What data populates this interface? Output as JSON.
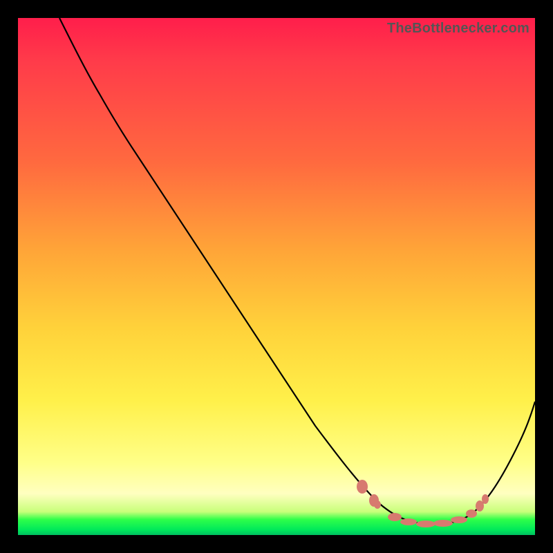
{
  "watermark": "TheBottlenecker.com",
  "chart_data": {
    "type": "line",
    "title": "",
    "xlabel": "",
    "ylabel": "",
    "xlim": [
      0,
      100
    ],
    "ylim": [
      0,
      100
    ],
    "series": [
      {
        "name": "curve",
        "x": [
          8,
          10,
          14,
          18,
          25,
          35,
          45,
          55,
          62,
          67,
          70,
          73,
          76,
          79,
          82,
          85,
          88,
          90,
          93,
          96,
          100
        ],
        "y": [
          100,
          98,
          94,
          90,
          80,
          65,
          50,
          35,
          24,
          16,
          11,
          8,
          6,
          5,
          5,
          5,
          6,
          8,
          12,
          18,
          27
        ]
      }
    ],
    "markers": [
      {
        "x": 67,
        "y": 15
      },
      {
        "x": 69,
        "y": 12
      },
      {
        "x": 72,
        "y": 8
      },
      {
        "x": 74,
        "y": 6
      },
      {
        "x": 77,
        "y": 5
      },
      {
        "x": 80,
        "y": 5
      },
      {
        "x": 83,
        "y": 5
      },
      {
        "x": 86,
        "y": 6
      },
      {
        "x": 88,
        "y": 8
      },
      {
        "x": 90,
        "y": 11
      }
    ],
    "gradient_bands": [
      {
        "color": "#ff1e4b",
        "pos": 0
      },
      {
        "color": "#ffd23a",
        "pos": 60
      },
      {
        "color": "#ffff88",
        "pos": 86
      },
      {
        "color": "#00e85a",
        "pos": 99
      }
    ]
  }
}
